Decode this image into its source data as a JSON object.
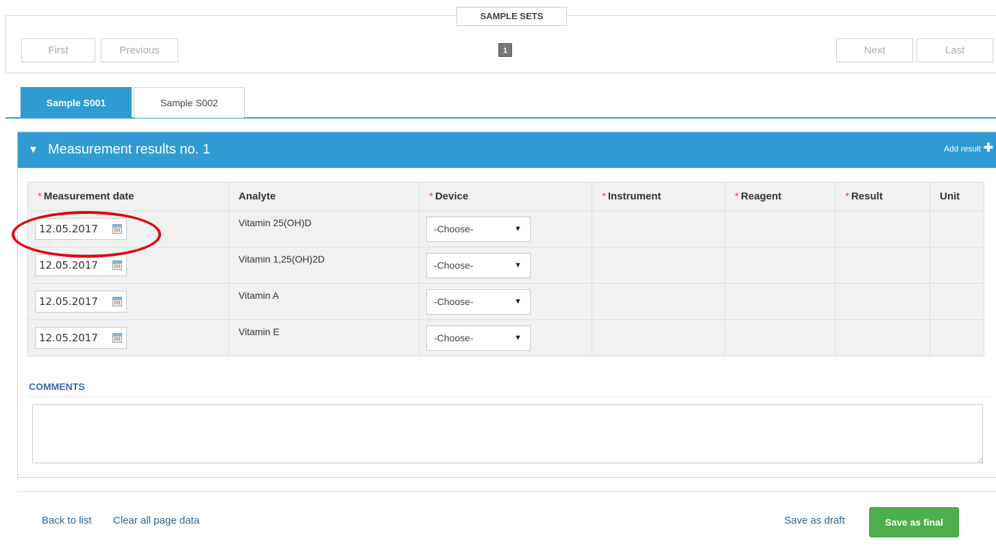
{
  "sample_sets": {
    "title": "SAMPLE SETS",
    "first": "First",
    "previous": "Previous",
    "page": "1",
    "next": "Next",
    "last": "Last"
  },
  "tabs": [
    {
      "label": "Sample S001",
      "active": true
    },
    {
      "label": "Sample S002",
      "active": false
    }
  ],
  "measurement": {
    "caret": "▼",
    "title": "Measurement results no. 1",
    "add_result": "Add result",
    "plus": "✚",
    "columns": [
      "Measurement date",
      "Analyte",
      "Device",
      "Instrument",
      "Reagent",
      "Result",
      "Unit"
    ],
    "required_mark": "*",
    "rows": [
      {
        "date": "12.05.2017",
        "analyte": "Vitamin 25(OH)D",
        "device": "-Choose-"
      },
      {
        "date": "12.05.2017",
        "analyte": "Vitamin 1,25(OH)2D",
        "device": "-Choose-"
      },
      {
        "date": "12.05.2017",
        "analyte": "Vitamin A",
        "device": "-Choose-"
      },
      {
        "date": "12.05.2017",
        "analyte": "Vitamin E",
        "device": "-Choose-"
      }
    ],
    "select_arrow": "▼"
  },
  "comments": {
    "label": "COMMENTS",
    "value": ""
  },
  "footer": {
    "back": "Back to list",
    "clear": "Clear all page data",
    "draft": "Save as draft",
    "final": "Save as final"
  },
  "colors": {
    "accent": "#2f9bd2",
    "required": "#e0463f",
    "save_final": "#4cae4c",
    "annotation": "#e3000f"
  }
}
